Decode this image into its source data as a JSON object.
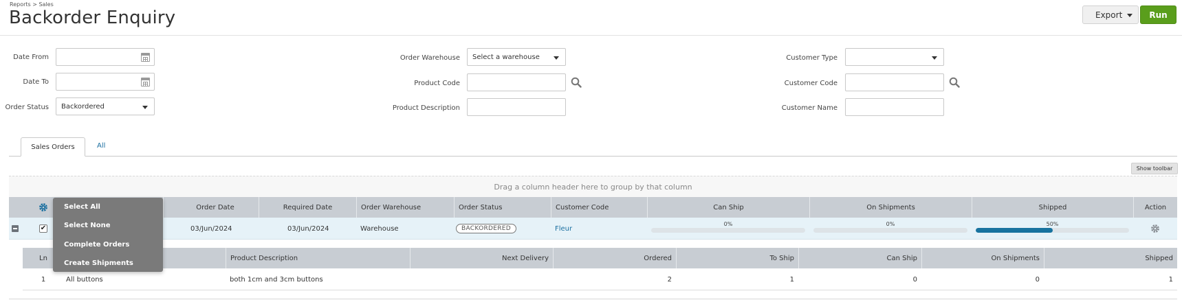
{
  "breadcrumb": "Reports > Sales",
  "title": "Backorder Enquiry",
  "actions": {
    "export": "Export",
    "run": "Run"
  },
  "filters": {
    "date_from_label": "Date From",
    "date_to_label": "Date To",
    "order_status_label": "Order Status",
    "order_status_value": "Backordered",
    "order_warehouse_label": "Order Warehouse",
    "order_warehouse_value": "Select a warehouse",
    "product_code_label": "Product Code",
    "product_description_label": "Product Description",
    "customer_type_label": "Customer Type",
    "customer_code_label": "Customer Code",
    "customer_name_label": "Customer Name"
  },
  "tabs": {
    "sales_orders": "Sales Orders",
    "all": "All"
  },
  "toolbar": {
    "show_toolbar": "Show toolbar"
  },
  "grid": {
    "group_hint": "Drag a column header here to group by that column",
    "columns": {
      "order_date": "Order Date",
      "required_date": "Required Date",
      "order_warehouse": "Order Warehouse",
      "order_status": "Order Status",
      "customer_code": "Customer Code",
      "can_ship": "Can Ship",
      "on_shipments": "On Shipments",
      "shipped": "Shipped",
      "action": "Action"
    },
    "row": {
      "checked": "✔",
      "order_date": "03/Jun/2024",
      "required_date": "03/Jun/2024",
      "order_warehouse": "Warehouse",
      "order_status": "BACKORDERED",
      "customer_code": "Fleur",
      "can_ship_label": "0%",
      "can_ship_fraction": 0,
      "on_shipments_label": "0%",
      "on_shipments_fraction": 0,
      "shipped_label": "50%",
      "shipped_fraction": 0.5
    }
  },
  "detail": {
    "columns": {
      "ln": "Ln",
      "product_description": "Product Description",
      "next_delivery": "Next Delivery",
      "ordered": "Ordered",
      "to_ship": "To Ship",
      "can_ship": "Can Ship",
      "on_shipments": "On Shipments",
      "shipped": "Shipped"
    },
    "row": {
      "ln": "1",
      "product": "All buttons",
      "product_description": "both 1cm and 3cm buttons",
      "ordered": "2",
      "to_ship": "1",
      "can_ship": "0",
      "on_shipments": "0",
      "shipped": "1"
    }
  },
  "popup_menu": {
    "select_all": "Select All",
    "select_none": "Select None",
    "complete_orders": "Complete Orders",
    "create_shipments": "Create Shipments"
  },
  "colors": {
    "run": "#5a9e1c",
    "link": "#1a6fa0",
    "progress": "#18739f",
    "header": "#c8cdd3",
    "popup": "#7a7a7a"
  },
  "icons": [
    "calendar-icon",
    "dropdown-caret-icon",
    "search-icon",
    "gear-icon",
    "collapse-icon",
    "checkbox-checked-icon"
  ]
}
